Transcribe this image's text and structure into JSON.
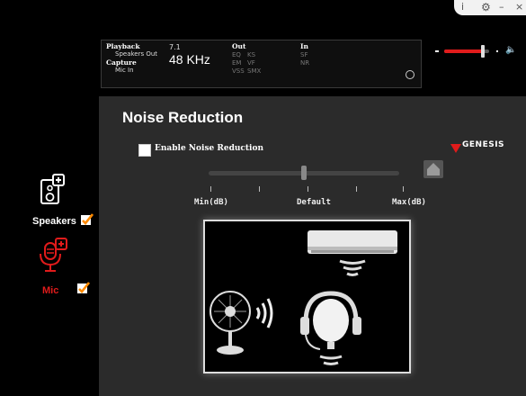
{
  "info_bar": {
    "playback_label": "Playback",
    "playback_device": "Speakers Out",
    "capture_label": "Capture",
    "capture_device": "Mic In",
    "channels": "7.1",
    "sample_rate": "48 KHz",
    "out_label": "Out",
    "out_items": [
      "EQ",
      "KS",
      "EM",
      "VF",
      "VSS",
      "SMX"
    ],
    "in_label": "In",
    "in_items": [
      "SF",
      "NR"
    ]
  },
  "volume": {
    "level_fraction": 0.85
  },
  "sidebar": {
    "speakers_label": "Speakers",
    "mic_label": "Mic",
    "speakers_checked": true,
    "mic_checked": true
  },
  "panel": {
    "title": "Noise Reduction",
    "enable_label": "Enable Noise Reduction",
    "enabled": false,
    "slider_level_fraction": 0.5,
    "slider_labels": {
      "min": "Min(dB)",
      "default": "Default",
      "max": "Max(dB)"
    }
  },
  "brand": {
    "logo_text": "GENESIS"
  },
  "colors": {
    "accent_red": "#e01b1b",
    "panel_bg": "#2b2b2b",
    "checkmark_orange": "#ff8a00"
  },
  "icons": [
    "info-icon",
    "settings-icon",
    "minimize-icon",
    "close-icon",
    "speaker-icon",
    "mic-icon",
    "home-icon",
    "speaker-volume-icon",
    "air-conditioner-icon",
    "fan-icon",
    "headset-icon"
  ]
}
